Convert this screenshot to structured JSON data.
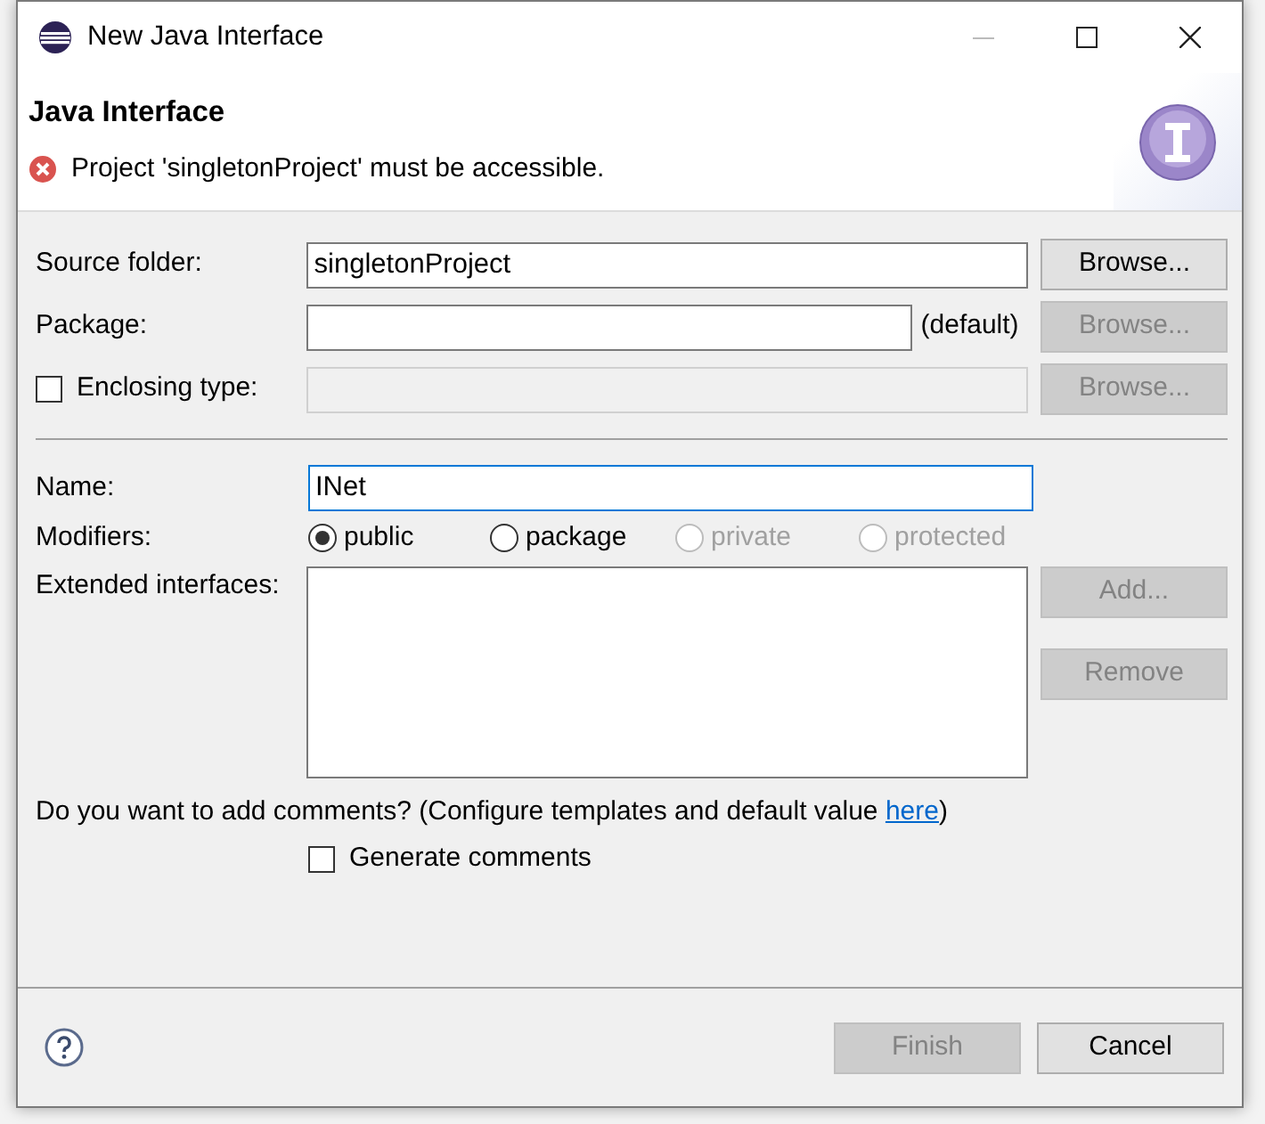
{
  "window": {
    "title": "New Java Interface"
  },
  "header": {
    "title": "Java Interface",
    "message": "Project 'singletonProject' must be accessible."
  },
  "source_folder": {
    "label": "Source folder:",
    "value": "singletonProject",
    "button": {
      "label": "Browse...",
      "disabled": false
    }
  },
  "package": {
    "label": "Package:",
    "suffix": "(default)",
    "button": {
      "label": "Browse...",
      "disabled": true
    }
  },
  "enclosing_type": {
    "label": "Enclosing type:",
    "checked": false,
    "field_disabled": true,
    "button": {
      "label": "Browse...",
      "disabled": true
    }
  },
  "name": {
    "label": "Name:",
    "value": "INet",
    "focused": true
  },
  "modifiers": {
    "label": "Modifiers:",
    "options": [
      {
        "label": "public",
        "selected": true,
        "disabled": false
      },
      {
        "label": "package",
        "selected": false,
        "disabled": false
      },
      {
        "label": "private",
        "selected": false,
        "disabled": true
      },
      {
        "label": "protected",
        "selected": false,
        "disabled": true
      }
    ]
  },
  "extended_interfaces": {
    "label": "Extended interfaces:",
    "buttons": [
      {
        "label": "Add...",
        "disabled": true
      },
      {
        "label": "Remove",
        "disabled": true
      }
    ]
  },
  "comments": {
    "prompt": "Do you want to add comments? (Configure templates and default value ",
    "link": "here",
    "after": ")",
    "checkbox": {
      "label": "Generate comments",
      "checked": false
    }
  },
  "footer": {
    "buttons": [
      {
        "label": "Finish",
        "disabled": true
      },
      {
        "label": "Cancel",
        "disabled": false
      }
    ]
  }
}
